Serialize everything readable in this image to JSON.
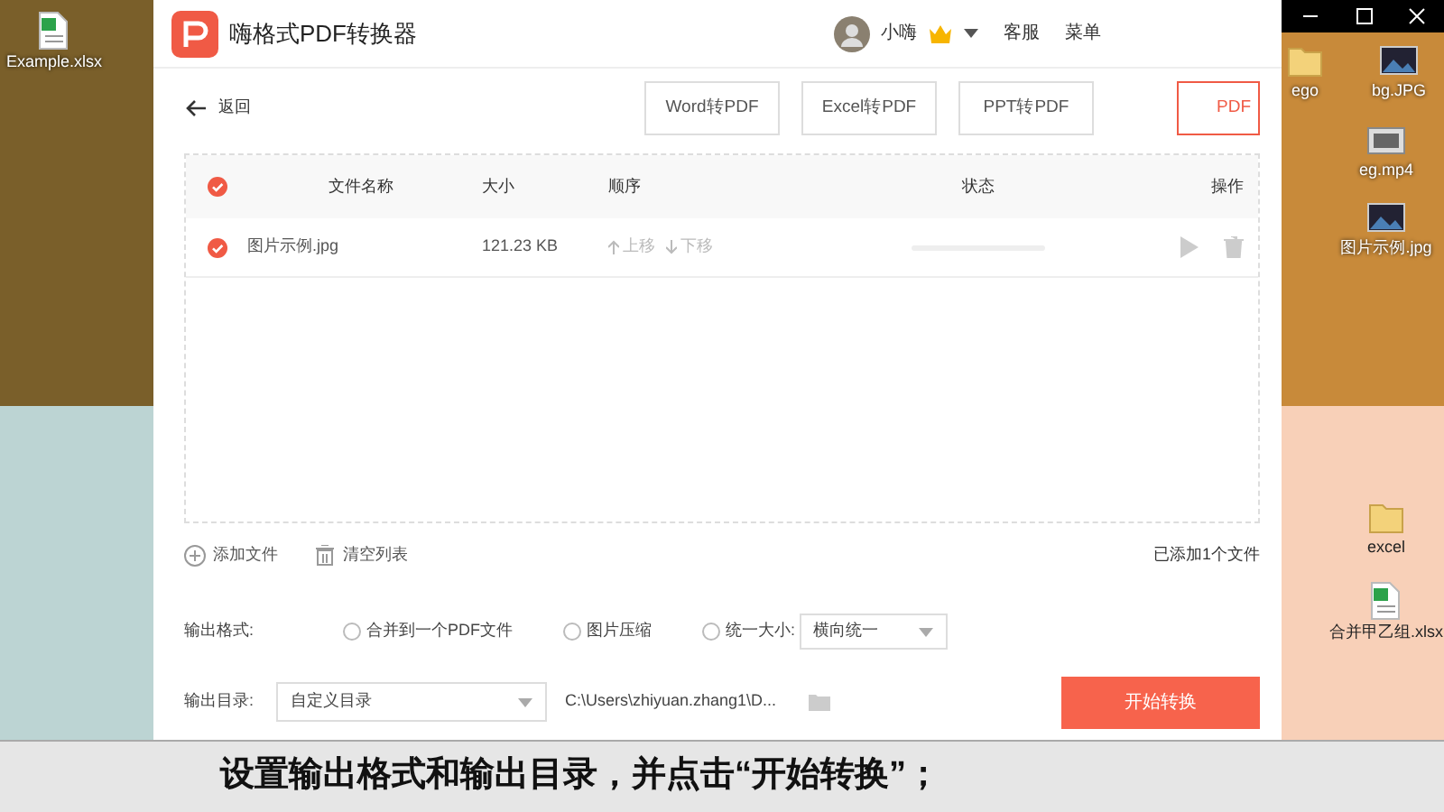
{
  "desktop_left": {
    "icons": [
      {
        "label": "Example.xlsx",
        "kind": "sheet"
      }
    ]
  },
  "desktop_right": {
    "icons": [
      {
        "label": "ego",
        "kind": "folder"
      },
      {
        "label": "bg.JPG",
        "kind": "image"
      },
      {
        "label": "eg.mp4",
        "kind": "video"
      },
      {
        "label": "图片示例.jpg",
        "kind": "image"
      },
      {
        "label": "excel",
        "kind": "folder"
      },
      {
        "label": "合并甲乙组.xlsx",
        "kind": "sheet"
      }
    ]
  },
  "window": {
    "title": "嗨格式PDF转换器",
    "user": "小嗨",
    "menu": [
      "客服",
      "菜单"
    ]
  },
  "toolbar": {
    "back": "返回",
    "tabs": [
      {
        "label": "Word转PDF",
        "selected": false
      },
      {
        "label": "Excel转PDF",
        "selected": false
      },
      {
        "label": "PPT转PDF",
        "selected": false
      },
      {
        "label": "PDF",
        "selected": true
      }
    ]
  },
  "table": {
    "all_checked": true,
    "columns": [
      "文件名称",
      "大小",
      "顺序",
      "状态",
      "操作"
    ],
    "rows": [
      {
        "checked": true,
        "name": "图片示例.jpg",
        "size": "121.23 KB",
        "move_up": "上移",
        "move_down": "下移",
        "level": 0
      }
    ]
  },
  "list_actions": [
    "添加文件",
    "清空列表"
  ],
  "file_count": "已添加1个文件",
  "output_format": {
    "label": "输出格式:",
    "options": [
      {
        "label": "合并到一个PDF文件",
        "selected": false
      },
      {
        "label": "图片压缩",
        "selected": false
      },
      {
        "label": "统一大小:",
        "selected": false,
        "select": "横向统一"
      }
    ]
  },
  "output_dir": {
    "label": "输出目录:",
    "select": "自定义目录",
    "path": "C:\\Users\\zhiyuan.zhang1\\D..."
  },
  "start_button": "开始转换",
  "caption": "设置输出格式和输出目录，并点击“开始转换”；"
}
